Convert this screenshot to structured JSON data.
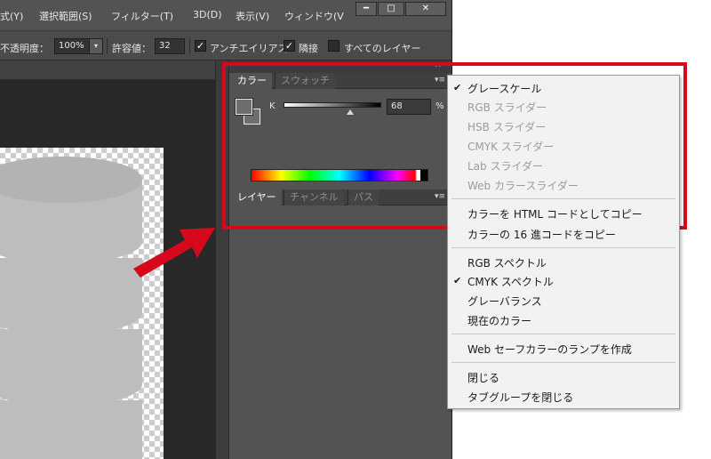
{
  "menubar": {
    "items": [
      "式(Y)",
      "選択範囲(S)",
      "フィルター(T)",
      "3D(D)",
      "表示(V)",
      "ウィンドウ(V"
    ],
    "window_controls": {
      "minimize": "━",
      "maximize": "□",
      "close": "✕"
    }
  },
  "options_bar": {
    "opacity_label": "不透明度：",
    "opacity_value": "100%",
    "tolerance_label": "許容値：",
    "tolerance_value": "32",
    "antialias_label": "アンチエイリアス",
    "contiguous_label": "隣接",
    "all_layers_label": "すべてのレイヤー",
    "dropdown_glyph": "▾",
    "check_glyph": "✓"
  },
  "panels": {
    "collapse_glyph": "▸▸",
    "menu_glyph": "▾≡",
    "color_tabs": [
      "カラー",
      "スウォッチ"
    ],
    "k_label": "K",
    "k_value": "68",
    "k_unit": "%",
    "layer_tabs": [
      "レイヤー",
      "チャンネル",
      "パス"
    ]
  },
  "context_menu": {
    "check_glyph": "✔",
    "items": [
      {
        "label": "グレースケール",
        "checked": true,
        "enabled": true
      },
      {
        "label": "RGB スライダー",
        "checked": false,
        "enabled": false
      },
      {
        "label": "HSB スライダー",
        "checked": false,
        "enabled": false
      },
      {
        "label": "CMYK スライダー",
        "checked": false,
        "enabled": false
      },
      {
        "label": "Lab スライダー",
        "checked": false,
        "enabled": false
      },
      {
        "label": "Web カラースライダー",
        "checked": false,
        "enabled": false
      },
      {
        "label": "カラーを HTML コードとしてコピー",
        "checked": false,
        "enabled": true
      },
      {
        "label": "カラーの 16 進コードをコピー",
        "checked": false,
        "enabled": true
      },
      {
        "label": "RGB スペクトル",
        "checked": false,
        "enabled": true
      },
      {
        "label": "CMYK スペクトル",
        "checked": true,
        "enabled": true
      },
      {
        "label": "グレーバランス",
        "checked": false,
        "enabled": true
      },
      {
        "label": "現在のカラー",
        "checked": false,
        "enabled": true
      },
      {
        "label": "Web セーフカラーのランプを作成",
        "checked": false,
        "enabled": true
      },
      {
        "label": "閉じる",
        "checked": false,
        "enabled": true
      },
      {
        "label": "タブグループを閉じる",
        "checked": false,
        "enabled": true
      }
    ]
  },
  "colors": {
    "highlight": "#d6081c",
    "arrow": "#d6081c",
    "swatch_gray": "#6e6e6e"
  }
}
